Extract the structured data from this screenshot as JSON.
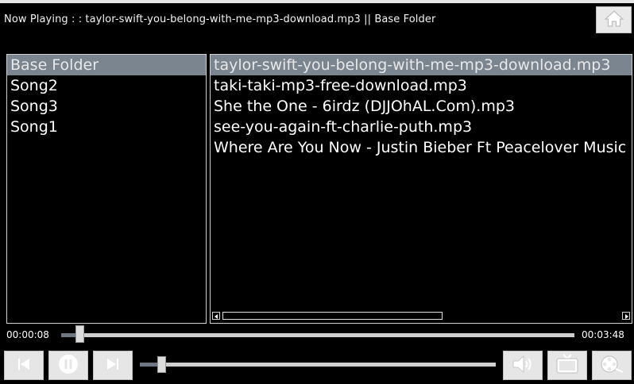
{
  "header": {
    "now_playing": "Now Playing : : taylor-swift-you-belong-with-me-mp3-download.mp3 || Base Folder"
  },
  "folders": {
    "items": [
      "Base Folder",
      "Song2",
      "Song3",
      "Song1"
    ],
    "selected_index": 0
  },
  "tracks": {
    "items": [
      "taylor-swift-you-belong-with-me-mp3-download.mp3",
      "taki-taki-mp3-free-download.mp3",
      "She the One - 6irdz (DJJOhAL.Com).mp3",
      "see-you-again-ft-charlie-puth.mp3",
      "Where Are You Now - Justin Bieber Ft Peacelover Music"
    ],
    "selected_index": 0
  },
  "playback": {
    "current_time": "00:00:08",
    "total_time": "00:03:48",
    "progress": 0.035
  },
  "volume": {
    "level": 0.06
  },
  "icons": {
    "home": "home-icon",
    "previous": "skip-previous-icon",
    "pause": "pause-icon",
    "next": "skip-next-icon",
    "volume": "speaker-icon",
    "tv": "tv-icon",
    "video": "film-reel-icon"
  },
  "colors": {
    "background": "#000000",
    "selection": "#7b8590",
    "button": "#e6e6e6"
  }
}
